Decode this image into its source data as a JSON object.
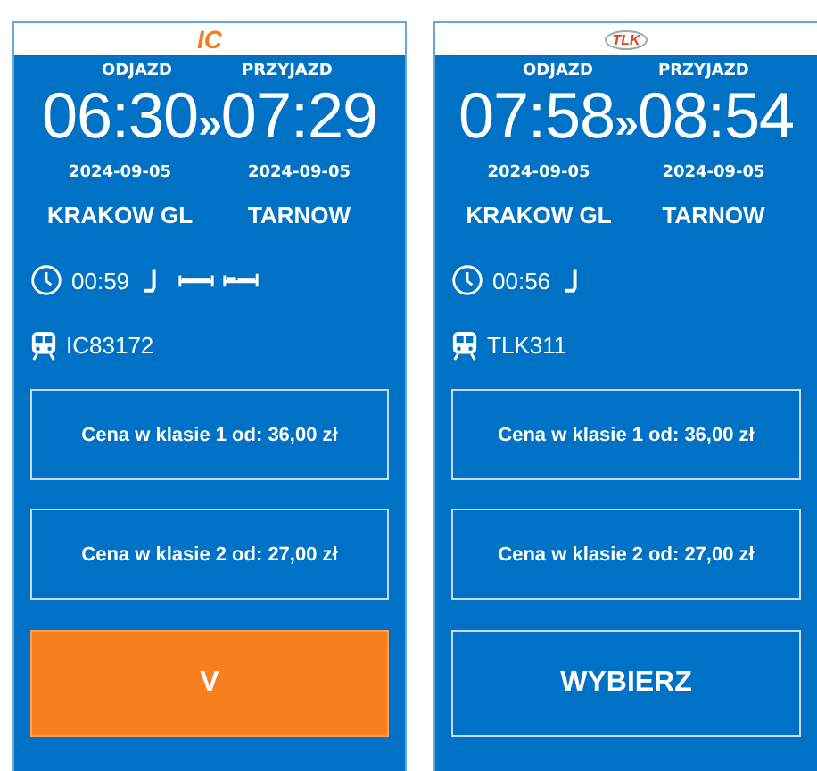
{
  "connections": [
    {
      "carrier": {
        "kind": "ic",
        "label": "IC"
      },
      "departure_label": "ODJAZD",
      "arrival_label": "PRZYJAZD",
      "departure_time": "06:30",
      "separator": "»",
      "arrival_time": "07:29",
      "departure_date": "2024-09-05",
      "arrival_date": "2024-09-05",
      "from": "KRAKOW GL",
      "to": "TARNOW",
      "duration": "00:59",
      "amenities": [
        {
          "kind": "seat"
        },
        {
          "kind": "bed"
        },
        {
          "kind": "couchette"
        }
      ],
      "train": "IC83172",
      "prices": [
        "Cena w klasie 1 od: 36,00 zł",
        "Cena w klasie 2 od: 27,00 zł"
      ],
      "button": {
        "label": "V",
        "selected": true
      }
    },
    {
      "carrier": {
        "kind": "tlk",
        "label": "TLK"
      },
      "departure_label": "ODJAZD",
      "arrival_label": "PRZYJAZD",
      "departure_time": "07:58",
      "separator": "»",
      "arrival_time": "08:54",
      "departure_date": "2024-09-05",
      "arrival_date": "2024-09-05",
      "from": "KRAKOW GL",
      "to": "TARNOW",
      "duration": "00:56",
      "amenities": [
        {
          "kind": "seat"
        }
      ],
      "train": "TLK311",
      "prices": [
        "Cena w klasie 1 od: 36,00 zł",
        "Cena w klasie 2 od: 27,00 zł"
      ],
      "button": {
        "label": "WYBIERZ",
        "selected": false
      }
    }
  ]
}
